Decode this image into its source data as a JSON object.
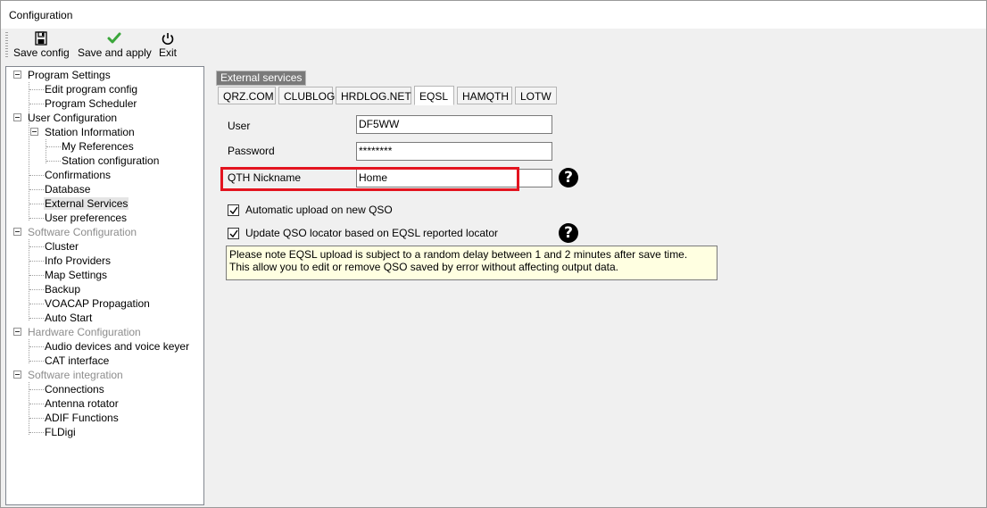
{
  "window": {
    "title": "Configuration"
  },
  "toolbar": {
    "save_config": "Save config",
    "save_apply": "Save and apply",
    "exit": "Exit"
  },
  "tree": {
    "program_settings": "Program Settings",
    "edit_program_config": "Edit program config",
    "program_scheduler": "Program Scheduler",
    "user_configuration": "User Configuration",
    "station_information": "Station Information",
    "my_references": "My References",
    "station_configuration": "Station configuration",
    "confirmations": "Confirmations",
    "database": "Database",
    "external_services": "External Services",
    "user_preferences": "User preferences",
    "software_configuration": "Software Configuration",
    "cluster": "Cluster",
    "info_providers": "Info Providers",
    "map_settings": "Map Settings",
    "backup": "Backup",
    "voacap": "VOACAP Propagation",
    "auto_start": "Auto Start",
    "hardware_configuration": "Hardware Configuration",
    "audio_devices": "Audio devices and voice keyer",
    "cat_interface": "CAT interface",
    "software_integration": "Software integration",
    "connections": "Connections",
    "antenna_rotator": "Antenna rotator",
    "adif_functions": "ADIF Functions",
    "fldigi": "FLDigi"
  },
  "panel": {
    "section_title": "External services",
    "tabs": [
      "QRZ.COM",
      "CLUBLOG",
      "HRDLOG.NET",
      "EQSL",
      "HAMQTH",
      "LOTW"
    ],
    "active_tab": "EQSL",
    "user_label": "User",
    "user_value": "DF5WW",
    "password_label": "Password",
    "password_value": "********",
    "qth_label": "QTH Nickname",
    "qth_value": "Home",
    "auto_upload_label": "Automatic upload on new QSO",
    "auto_upload_checked": true,
    "update_locator_label": "Update QSO locator based on EQSL reported locator",
    "update_locator_checked": true,
    "note_line1": "Please note EQSL upload is subject to a random delay between 1 and 2 minutes after save time.",
    "note_line2": "This allow you to edit or remove QSO saved by error without affecting output data.",
    "help_glyph": "?"
  },
  "colors": {
    "highlight": "#e3141f",
    "note_bg": "#ffffe1",
    "check_green": "#3aa63a"
  }
}
